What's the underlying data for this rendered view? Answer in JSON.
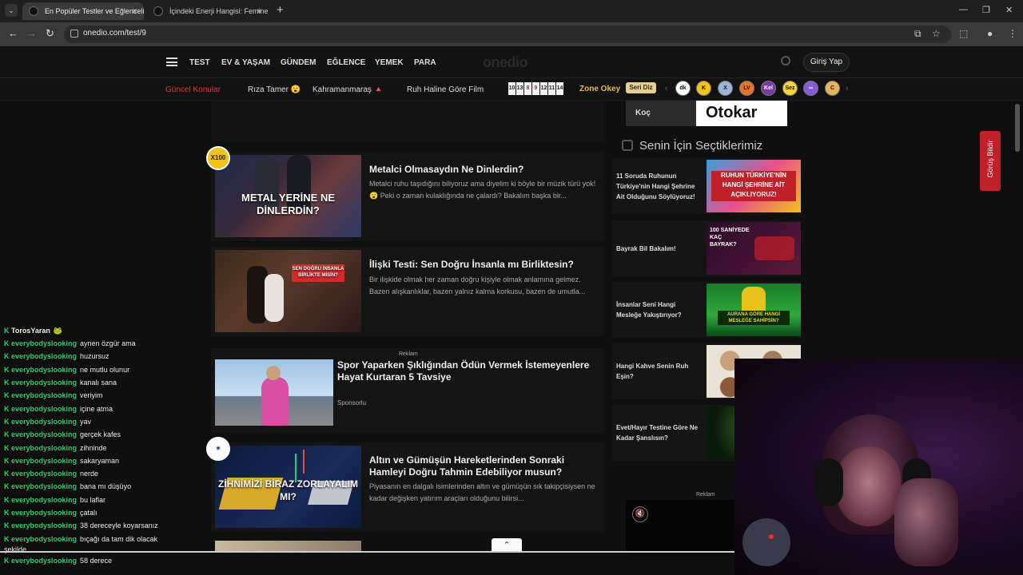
{
  "browser": {
    "tabs": [
      {
        "title": "En Popüler Testler ve Eğlenceli"
      },
      {
        "title": "İçindeki Enerji Hangisi: Feminen"
      }
    ],
    "url": "onedio.com/test/9"
  },
  "site": {
    "logo": "onedio",
    "nav": [
      "TEST",
      "EV & YAŞAM",
      "GÜNDEM",
      "EĞLENCE",
      "YEMEK",
      "PARA"
    ],
    "login": "Giriş Yap",
    "subnav": {
      "hot": "Güncel Konular",
      "items": [
        "Rıza Tamer 😮",
        "Kahramanmaraş 🔺",
        "Ruh Haline Göre Film"
      ],
      "numbers": [
        "10",
        "13",
        "8",
        "9",
        "12",
        "11",
        "14"
      ],
      "zone": "Zone Okey",
      "seri": "Seri Diz",
      "games": [
        "dk",
        "K",
        "X",
        "LV",
        "Kel",
        "Sez",
        "∞",
        "C"
      ]
    }
  },
  "main": {
    "cards": [
      {
        "thumb_text": "METAL YERİNE NE DİNLERDİN?",
        "title": "Metalci Olmasaydın Ne Dinlerdin?",
        "desc": "Metalci ruhu taşıdığını biliyoruz ama diyelim ki böyle bir müzik türü yok! 😮 Peki o zaman kulaklığında ne çalardı? Bakalım başka bir...",
        "badge": "X100"
      },
      {
        "thumb_text": "SEN DOĞRU İNSANLA BİRLİKTE MİSİN?",
        "title": "İlişki Testi: Sen Doğru İnsanla mı Birliktesin?",
        "desc": "Bir ilişkide olmak her zaman doğru kişiyle olmak anlamına gelmez. Bazen alışkanlıklar, bazen yalnız kalma korkusu, bazen de umutla..."
      },
      {
        "reklam": "Reklam",
        "title": "Spor Yaparken Şıklığından Ödün Vermek İstemeyenlere Hayat Kurtaran 5 Tavsiye",
        "sponsor": "Sponsorlu"
      },
      {
        "thumb_text": "ZİHNİMİZİ BİRAZ ZORLAYALIM MI?",
        "title": "Altın ve Gümüşün Hareketlerinden Sonraki Hamleyi Doğru Tahmin Edebiliyor musun?",
        "desc": "Piyasanın en dalgalı isimlerinden altın ve gümüşün sık takipçisiysen ne kadar değişken yatırım araçları olduğunu bilirsi..."
      }
    ]
  },
  "rail": {
    "ad": {
      "left": "Koç",
      "right": "Otokar"
    },
    "heading": "Senin İçin Seçtiklerimiz",
    "items": [
      {
        "text": "11 Soruda Ruhunun Türkiye'nin Hangi Şehrine Ait Olduğunu Söylüyoruz!",
        "img_text": "RUHUN TÜRKİYE'NİN HANGİ ŞEHRİNE AİT AÇIKLIYORUZ!"
      },
      {
        "text": "Bayrak Bil Bakalım!",
        "img_text": "100 SANİYEDE KAÇ BAYRAK?"
      },
      {
        "text": "İnsanlar Seni Hangi Mesleğe Yakıştırıyor?",
        "img_text": "AURANA GÖRE HANGİ MESLEĞE SAHİPSİN?"
      },
      {
        "text": "Hangi Kahve Senin Ruh Eşin?",
        "img_text": ""
      },
      {
        "text": "Evet/Hayır Testine Göre Ne Kadar Şanslısın?",
        "img_text": ""
      }
    ],
    "reklam": "Reklam",
    "feedback": "Görüş Bildir"
  },
  "chat": [
    {
      "user": "TorosYaran",
      "msg": "🐸"
    },
    {
      "user": "everybodyslooking",
      "msg": "aynen özgür ama"
    },
    {
      "user": "everybodyslooking",
      "msg": "huzursuz"
    },
    {
      "user": "everybodyslooking",
      "msg": "ne mutlu olunur"
    },
    {
      "user": "everybodyslooking",
      "msg": "kanalı sana"
    },
    {
      "user": "everybodyslooking",
      "msg": "veriyim"
    },
    {
      "user": "everybodyslooking",
      "msg": "içine atma"
    },
    {
      "user": "everybodyslooking",
      "msg": "yav"
    },
    {
      "user": "everybodyslooking",
      "msg": "gerçek kafes"
    },
    {
      "user": "everybodyslooking",
      "msg": "zihninde"
    },
    {
      "user": "everybodyslooking",
      "msg": "sakaryaman"
    },
    {
      "user": "everybodyslooking",
      "msg": "nerde"
    },
    {
      "user": "everybodyslooking",
      "msg": "bana mı düşüyo"
    },
    {
      "user": "everybodyslooking",
      "msg": "bu laflar"
    },
    {
      "user": "everybodyslooking",
      "msg": "çatalı"
    },
    {
      "user": "everybodyslooking",
      "msg": "38 dereceyle koyarsanız"
    },
    {
      "user": "everybodyslooking",
      "msg": "bıçağı da tam dik olacak"
    },
    {
      "user": "",
      "msg": "şekilde"
    },
    {
      "user": "everybodyslooking",
      "msg": "58 derece"
    }
  ]
}
